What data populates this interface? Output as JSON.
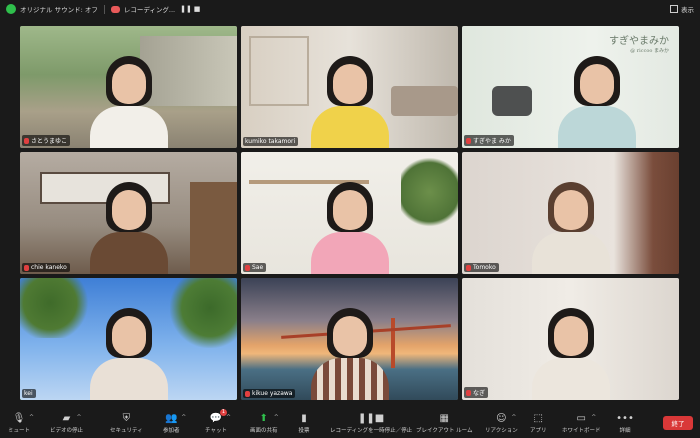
{
  "topbar": {
    "audio_label": "オリジナル サウンド: オフ",
    "recording_label": "レコーディング...",
    "view_label": "表示"
  },
  "participants": [
    {
      "name": "さとうまゆこ"
    },
    {
      "name": "kumiko takamori"
    },
    {
      "name": "すぎやま みか"
    },
    {
      "name": "chie kaneko"
    },
    {
      "name": "Sae"
    },
    {
      "name": "Tomoko"
    },
    {
      "name": "kei"
    },
    {
      "name": "kikue yazawa"
    },
    {
      "name": "なぎ"
    }
  ],
  "watermark": {
    "line1": "すぎやまみか",
    "line2": "@ riccoo まみか"
  },
  "toolbar": {
    "mute": "ミュート",
    "video": "ビデオの停止",
    "security": "セキュリティ",
    "participants": "参加者",
    "participants_count": "9",
    "chat": "チャット",
    "chat_badge": "1",
    "share": "画面の共有",
    "poll": "投票",
    "record": "レコーディングを一時停止／停止",
    "breakout": "ブレイクアウト ルーム",
    "reactions": "リアクション",
    "apps": "アプリ",
    "whiteboard": "ホワイトボード",
    "more": "詳細",
    "end": "終了"
  }
}
